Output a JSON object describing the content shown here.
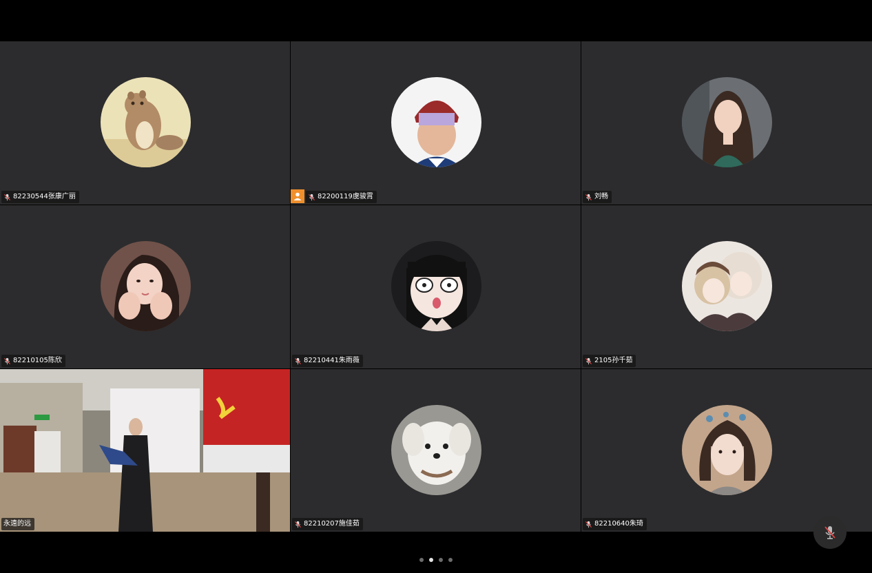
{
  "meeting": {
    "participants": [
      {
        "label": "82230544张康广丽",
        "muted": true,
        "host": false,
        "avatar_icon": "cartoon-otter-avatar",
        "bg": "#e9dcae"
      },
      {
        "label": "82200119虞骏霄",
        "muted": true,
        "host": true,
        "avatar_icon": "portrait-red-cap-avatar",
        "bg": "#f1f1f1"
      },
      {
        "label": "刘畅",
        "muted": true,
        "host": false,
        "avatar_icon": "portrait-woman-avatar",
        "bg": "#5a5048"
      },
      {
        "label": "82210105陈欣",
        "muted": true,
        "host": false,
        "avatar_icon": "portrait-hands-face-avatar",
        "bg": "#6d4e45"
      },
      {
        "label": "82210441朱雨薇",
        "muted": true,
        "host": false,
        "avatar_icon": "anime-surprised-girl-avatar",
        "bg": "#1e1e1e"
      },
      {
        "label": "2105孙千茹",
        "muted": true,
        "host": false,
        "avatar_icon": "anime-couple-avatar",
        "bg": "#e8e2dd"
      },
      {
        "label": "永遠的远",
        "muted": false,
        "host": false,
        "avatar_icon": "camera-video-feed",
        "bg": "#7d7a73"
      },
      {
        "label": "82210207施佳茹",
        "muted": true,
        "host": false,
        "avatar_icon": "white-puppy-avatar",
        "bg": "#8b8b88"
      },
      {
        "label": "82210640朱琦",
        "muted": true,
        "host": false,
        "avatar_icon": "portrait-baby-shark-avatar",
        "bg": "#c2a58c"
      }
    ]
  },
  "pagination": {
    "pages": 4,
    "current": 2
  },
  "controls": {
    "floating_mic_icon": "mic-muted-icon"
  },
  "colors": {
    "tile_bg": "#2c2c2e",
    "host_badge": "#f0902c",
    "label_bg": "#141414"
  }
}
